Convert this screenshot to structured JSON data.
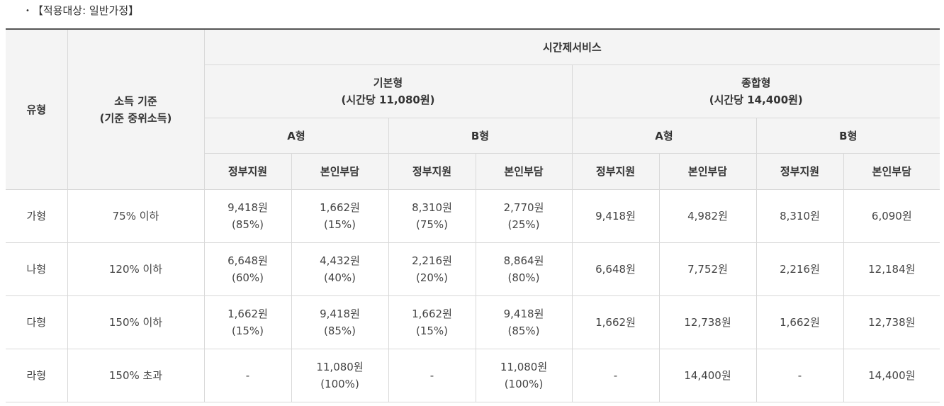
{
  "caption": "【적용대상: 일반가정】",
  "header": {
    "type_label": "유형",
    "income_label_1": "소득 기준",
    "income_label_2": "(기준 중위소득)",
    "service": "시간제서비스",
    "basic_name": "기본형",
    "basic_rate": "(시간당 11,080원)",
    "combined_name": "종합형",
    "combined_rate": "(시간당 14,400원)",
    "type_a": "A형",
    "type_b": "B형",
    "gov": "정부지원",
    "self": "본인부담"
  },
  "rows": [
    {
      "type": "가형",
      "income": "75% 이하",
      "cells": [
        [
          "9,418원",
          "(85%)"
        ],
        [
          "1,662원",
          "(15%)"
        ],
        [
          "8,310원",
          "(75%)"
        ],
        [
          "2,770원",
          "(25%)"
        ],
        [
          "9,418원",
          ""
        ],
        [
          "4,982원",
          ""
        ],
        [
          "8,310원",
          ""
        ],
        [
          "6,090원",
          ""
        ]
      ]
    },
    {
      "type": "나형",
      "income": "120% 이하",
      "cells": [
        [
          "6,648원",
          "(60%)"
        ],
        [
          "4,432원",
          "(40%)"
        ],
        [
          "2,216원",
          "(20%)"
        ],
        [
          "8,864원",
          "(80%)"
        ],
        [
          "6,648원",
          ""
        ],
        [
          "7,752원",
          ""
        ],
        [
          "2,216원",
          ""
        ],
        [
          "12,184원",
          ""
        ]
      ]
    },
    {
      "type": "다형",
      "income": "150% 이하",
      "cells": [
        [
          "1,662원",
          "(15%)"
        ],
        [
          "9,418원",
          "(85%)"
        ],
        [
          "1,662원",
          "(15%)"
        ],
        [
          "9,418원",
          "(85%)"
        ],
        [
          "1,662원",
          ""
        ],
        [
          "12,738원",
          ""
        ],
        [
          "1,662원",
          ""
        ],
        [
          "12,738원",
          ""
        ]
      ]
    },
    {
      "type": "라형",
      "income": "150% 초과",
      "cells": [
        [
          "-",
          ""
        ],
        [
          "11,080원",
          "(100%)"
        ],
        [
          "-",
          ""
        ],
        [
          "11,080원",
          "(100%)"
        ],
        [
          "-",
          ""
        ],
        [
          "14,400원",
          ""
        ],
        [
          "-",
          ""
        ],
        [
          "14,400원",
          ""
        ]
      ]
    }
  ]
}
